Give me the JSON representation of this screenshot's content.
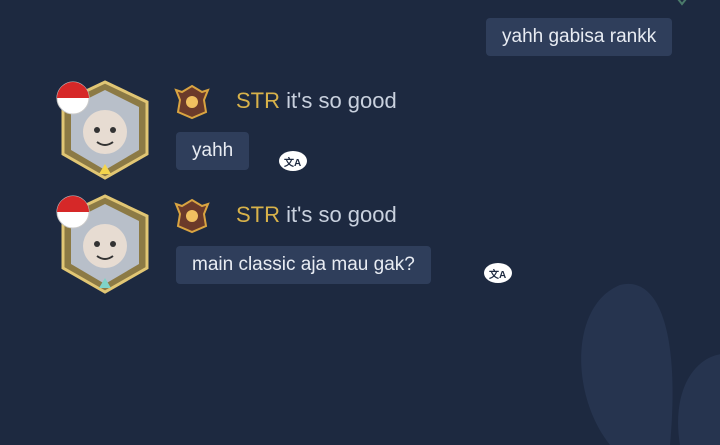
{
  "colors": {
    "background": "#1d2940",
    "bubble": "#2f3e5b",
    "name_gold": "#d8b24a",
    "text": "#e8ecf3"
  },
  "outgoing": {
    "text": "yahh gabisa rankk"
  },
  "messages": [
    {
      "sender_name": "STR",
      "sender_status": "it's so good",
      "text": "yahh",
      "avatar_icon": "hero-avatar-with-indonesia-flag",
      "rank_icon": "rank-emblem-icon",
      "action_icon": "translate-icon"
    },
    {
      "sender_name": "STR",
      "sender_status": "it's so good",
      "text": "main classic aja mau gak?",
      "avatar_icon": "hero-avatar-with-indonesia-flag",
      "rank_icon": "rank-emblem-icon",
      "action_icon": "translate-icon"
    }
  ]
}
